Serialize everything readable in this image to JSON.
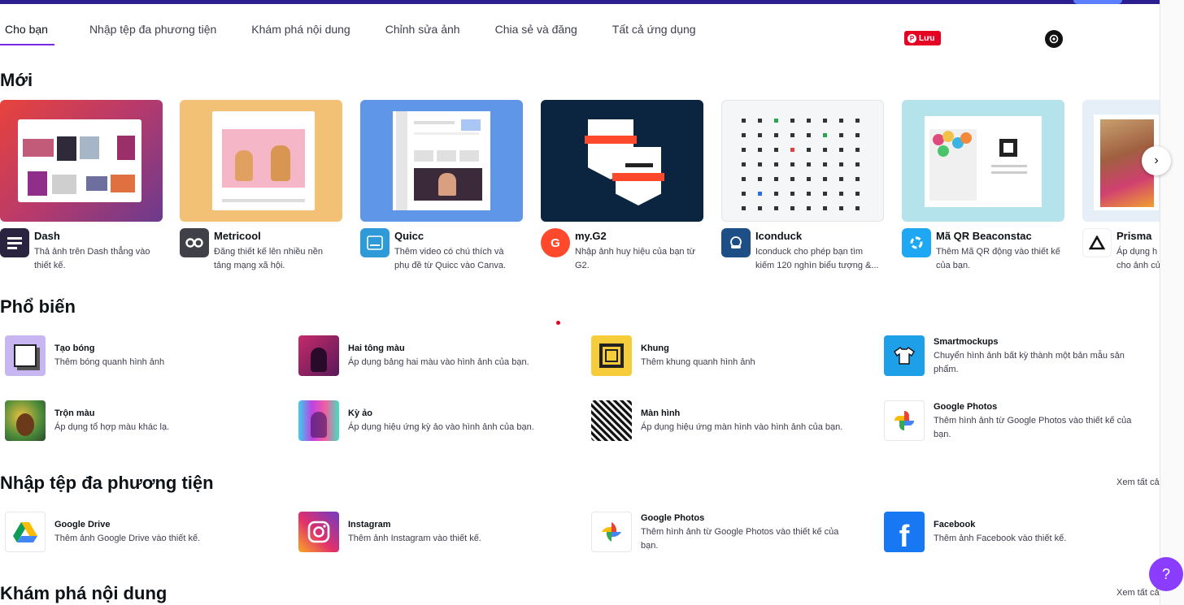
{
  "tabs": [
    "Cho bạn",
    "Nhập tệp đa phương tiện",
    "Khám phá nội dung",
    "Chỉnh sửa ảnh",
    "Chia sẻ và đăng",
    "Tất cả ứng dụng"
  ],
  "pin_label": "Lưu",
  "sections": {
    "new": "Mới",
    "popular": "Phổ biến",
    "import": "Nhập tệp đa phương tiện",
    "explore": "Khám phá nội dung"
  },
  "see_all": "Xem tất cả",
  "see_all_cut": "Xem tất cả",
  "new_apps": [
    {
      "name": "Dash",
      "desc": "Thả ảnh trên Dash thẳng vào\nthiết kế."
    },
    {
      "name": "Metricool",
      "desc": "Đăng thiết kế lên nhiều nền\ntảng mạng xã hội."
    },
    {
      "name": "Quicc",
      "desc": "Thêm video có chú thích và\nphụ đề từ Quicc vào Canva."
    },
    {
      "name": "my.G2",
      "desc": "Nhập ảnh huy hiệu của bạn từ\nG2."
    },
    {
      "name": "Iconduck",
      "desc": "Iconduck cho phép bạn tìm\nkiếm 120 nghìn biểu tượng &..."
    },
    {
      "name": "Mã QR Beaconstac",
      "desc": "Thêm Mã QR động vào thiết kế\ncủa bạn."
    },
    {
      "name": "Prisma",
      "desc": "Áp dụng h\ncho ảnh củ"
    }
  ],
  "popular_apps": [
    {
      "name": "Tạo bóng",
      "desc": "Thêm bóng quanh hình ảnh"
    },
    {
      "name": "Hai tông màu",
      "desc": "Áp dụng bảng hai màu vào hình ảnh của bạn."
    },
    {
      "name": "Khung",
      "desc": "Thêm khung quanh hình ảnh"
    },
    {
      "name": "Smartmockups",
      "desc": "Chuyển hình ảnh bất kỳ thành một bản mẫu sản phẩm."
    },
    {
      "name": "Trộn màu",
      "desc": "Áp dụng tổ hợp màu khác lạ."
    },
    {
      "name": "Kỳ ảo",
      "desc": "Áp dụng hiệu ứng kỳ ảo vào hình ảnh của bạn."
    },
    {
      "name": "Màn hình",
      "desc": "Áp dụng hiệu ứng màn hình vào hình ảnh của bạn."
    },
    {
      "name": "Google Photos",
      "desc": "Thêm hình ảnh từ Google Photos vào thiết kế của bạn."
    }
  ],
  "import_apps": [
    {
      "name": "Google Drive",
      "desc": "Thêm ảnh Google Drive vào thiết kế."
    },
    {
      "name": "Instagram",
      "desc": "Thêm ảnh Instagram vào thiết kế."
    },
    {
      "name": "Google Photos",
      "desc": "Thêm hình ảnh từ Google Photos vào thiết kế của bạn."
    },
    {
      "name": "Facebook",
      "desc": "Thêm ảnh Facebook vào thiết kế."
    }
  ],
  "help_label": "?",
  "colors": {
    "accent": "#7d2ae8",
    "help": "#8b3dff",
    "topbar": "#2b1f8f",
    "pinterest": "#e60023"
  }
}
